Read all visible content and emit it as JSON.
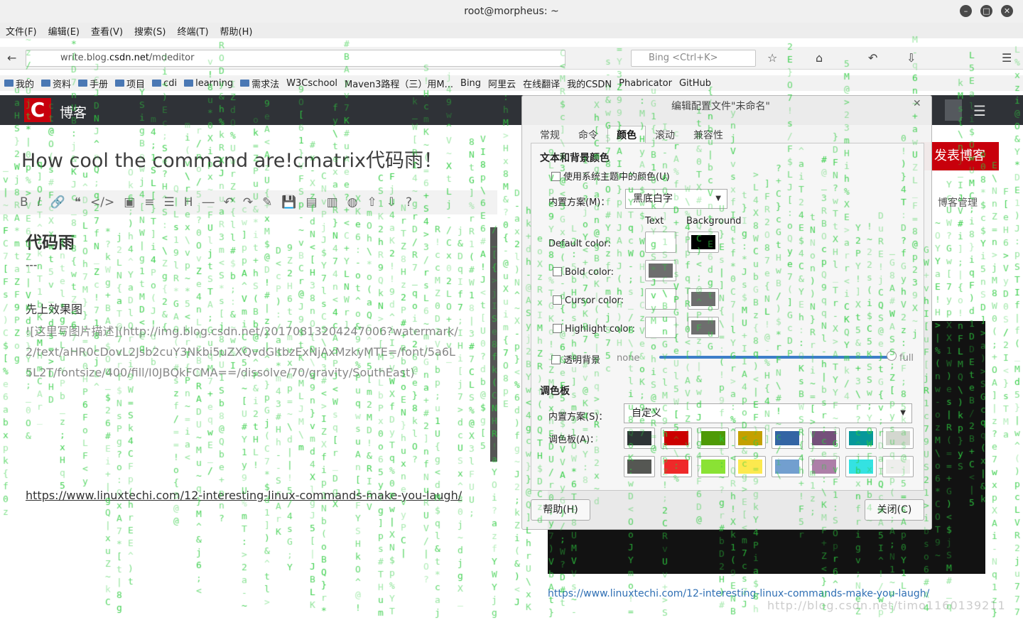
{
  "window": {
    "title": "root@morpheus: ~"
  },
  "menu": [
    "文件(F)",
    "编辑(E)",
    "查看(V)",
    "搜索(S)",
    "终端(T)",
    "帮助(H)"
  ],
  "browser": {
    "url_prefix": "write.blog.",
    "url_host": "csdn.net",
    "url_path": "/mdeditor",
    "search_placeholder": "Bing <Ctrl+K>",
    "bookmarks": [
      "我的",
      "资料",
      "手册",
      "项目",
      "cdi",
      "learning",
      "需求法",
      "W3Cschool",
      "Maven3路程（三）用M...",
      "Bing",
      "阿里云",
      "在线翻译",
      "我的CSDN",
      "Phabricator",
      "GitHub"
    ]
  },
  "blog": {
    "header_label": "博客",
    "logo_letter": "C",
    "article_title": "How cool the command are!cmatrix代码雨！",
    "publish_button": "发表博客",
    "manage_label": "博客管理",
    "heading": "代码雨",
    "rule": "---",
    "para": "先上效果图",
    "image_markup": "![这里写图片描述](http://img.blog.csdn.net/20170813204247006?watermark/2/text/aHR0cDovL2Jsb2cuY3Nkbi5uZXQvdGltbzExNjAxMzkyMTE=/font/5a6L5L2T/fontsize/400/fill/I0JBQkFCMA==/dissolve/70/gravity/SouthEast)",
    "link": "https://www.linuxtechi.com/12-interesting-linux-commands-make-you-laugh/",
    "preview_link": "https://www.linuxtechi.com/12-interesting-linux-commands-make-you-laugh/",
    "watermark": "http://blog.csdn.net/timo1160139211"
  },
  "dialog": {
    "title": "编辑配置文件\"未命名\"",
    "tabs": [
      "常规",
      "命令",
      "颜色",
      "滚动",
      "兼容性"
    ],
    "active_tab": "颜色",
    "section_text_bg": "文本和背景颜色",
    "use_system_theme": "使用系统主题中的颜色(U)",
    "builtin_scheme_label": "内置方案(M)：",
    "builtin_scheme_value": "黑底白字",
    "col_text": "Text",
    "col_background": "Background",
    "default_color": "Default color:",
    "bold_color": "Bold color:",
    "cursor_color": "Cursor color:",
    "highlight_color": "Highlight color:",
    "transparent_bg": "透明背景",
    "slider_none": "none",
    "slider_full": "full",
    "transparency": 0.97,
    "section_palette": "调色板",
    "palette_scheme_label": "内置方案(S)：",
    "palette_scheme_value": "自定义",
    "palette_label": "调色板(A)：",
    "palette_row1": [
      "#2e3436",
      "#cc0000",
      "#4e9a06",
      "#c4a000",
      "#3465a4",
      "#75507b",
      "#06989a",
      "#d3d7cf"
    ],
    "palette_row2": [
      "#555753",
      "#ef2929",
      "#8ae234",
      "#fce94f",
      "#729fcf",
      "#ad7fa8",
      "#34e2e2",
      "#eeeeec"
    ],
    "default_text_swatch": "#ffffff",
    "default_bg_swatch": "#000000",
    "disabled_swatch": "#6e6e6e",
    "help_button": "帮助(H)",
    "close_button": "关闭(C)"
  },
  "matrix": {
    "color": "#2ecc40"
  }
}
